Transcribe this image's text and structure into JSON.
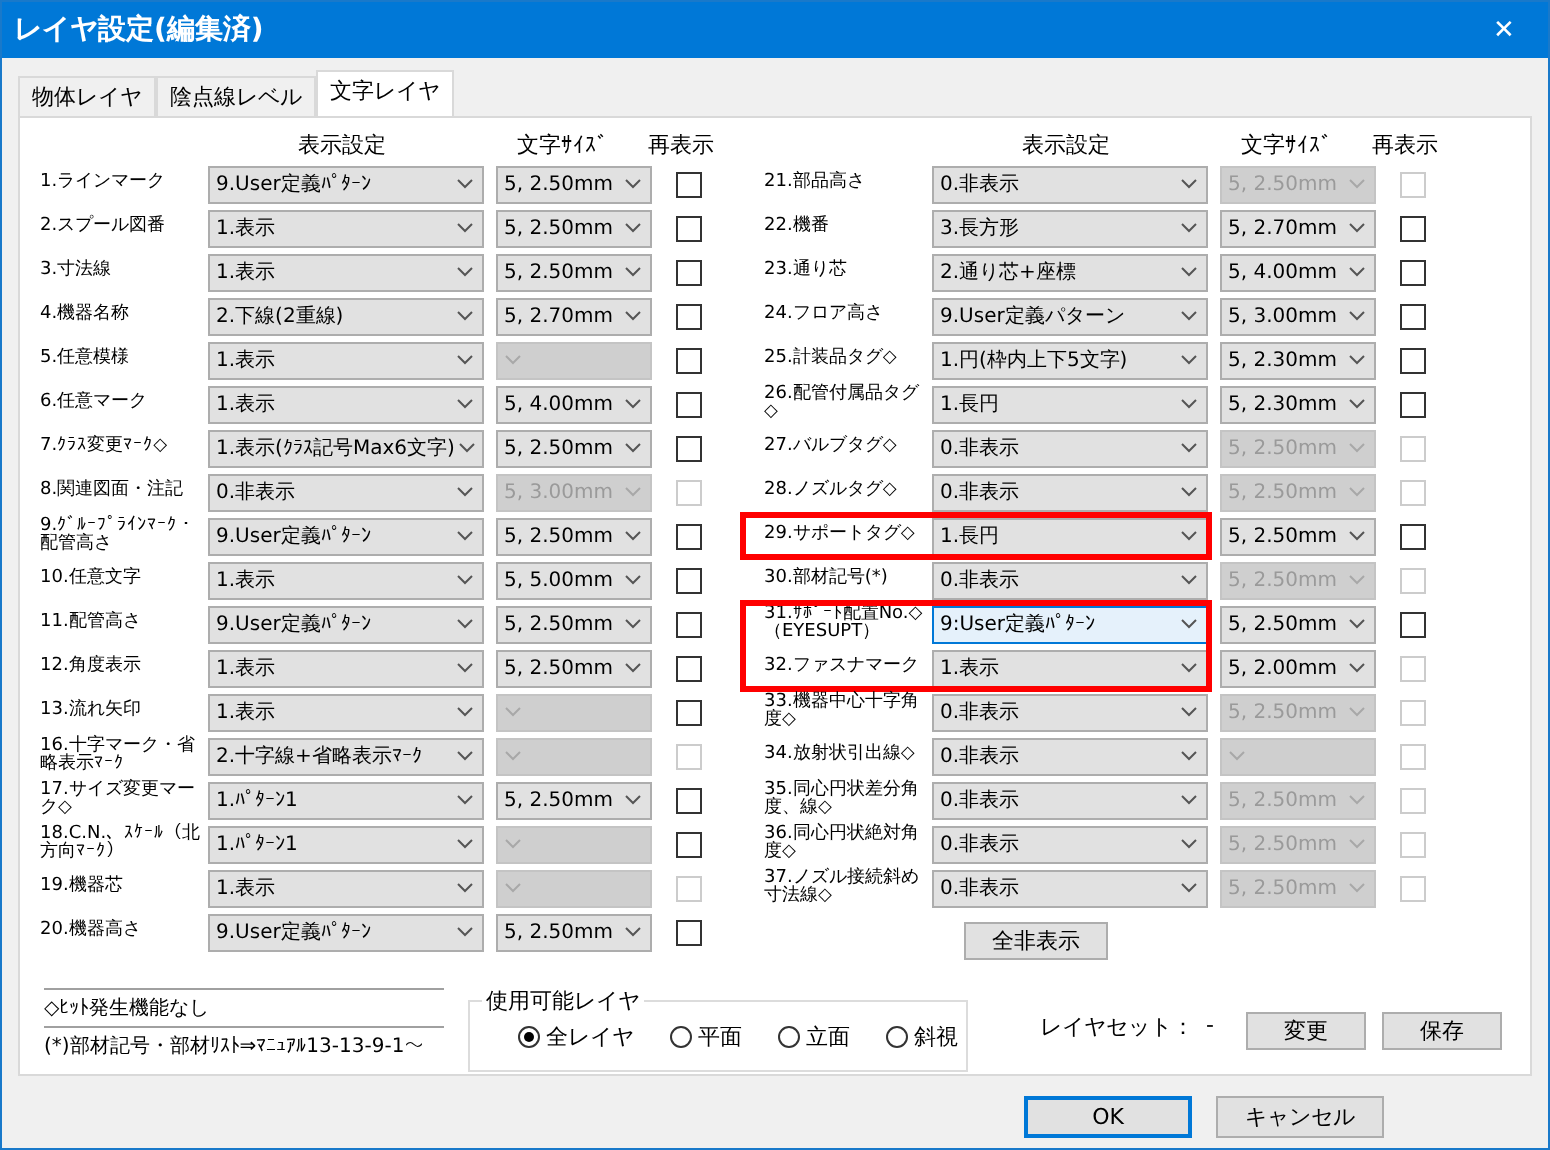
{
  "window": {
    "title": "レイヤ設定(編集済)",
    "close": "✕"
  },
  "tabs": [
    {
      "label": "物体レイヤ",
      "selected": false
    },
    {
      "label": "陰点線レベル",
      "selected": false
    },
    {
      "label": "文字レイヤ",
      "selected": true
    }
  ],
  "columns": [
    {
      "headers": [
        "表示設定",
        "文字ｻｲｽﾞ",
        "再表示"
      ],
      "rows": [
        {
          "label": "1.ラインマーク",
          "setting": "9.User定義ﾊﾟﾀｰﾝ",
          "size": "5, 2.50mm",
          "size_enabled": true,
          "checkbox_disabled": false,
          "checked": false,
          "focused": false,
          "highlighted": false
        },
        {
          "label": "2.スプール図番",
          "setting": "1.表示",
          "size": "5, 2.50mm",
          "size_enabled": true,
          "checkbox_disabled": false,
          "checked": false,
          "focused": false,
          "highlighted": false
        },
        {
          "label": "3.寸法線",
          "setting": "1.表示",
          "size": "5, 2.50mm",
          "size_enabled": true,
          "checkbox_disabled": false,
          "checked": false,
          "focused": false,
          "highlighted": false
        },
        {
          "label": "4.機器名称",
          "setting": "2.下線(2重線)",
          "size": "5, 2.70mm",
          "size_enabled": true,
          "checkbox_disabled": false,
          "checked": false,
          "focused": false,
          "highlighted": false
        },
        {
          "label": "5.任意模様",
          "setting": "1.表示",
          "size_enabled": false,
          "checkbox_disabled": false,
          "checked": false,
          "focused": false,
          "highlighted": false
        },
        {
          "label": "6.任意マーク",
          "setting": "1.表示",
          "size": "5, 4.00mm",
          "size_enabled": true,
          "checkbox_disabled": false,
          "checked": false,
          "focused": false,
          "highlighted": false
        },
        {
          "label": "7.ｸﾗｽ変更ﾏｰｸ◇",
          "setting": "1.表示(ｸﾗｽ記号Max6文字)",
          "size": "5, 2.50mm",
          "size_enabled": true,
          "checkbox_disabled": false,
          "checked": false,
          "focused": false,
          "highlighted": false
        },
        {
          "label": "8.関連図面・注記",
          "setting": "0.非表示",
          "size": "5, 3.00mm",
          "size_enabled": false,
          "checkbox_disabled": true,
          "checked": false,
          "focused": false,
          "highlighted": false
        },
        {
          "label": "9.ｸﾞﾙｰﾌﾟﾗｲﾝﾏｰｸ・配管高さ",
          "setting": "9.User定義ﾊﾟﾀｰﾝ",
          "size": "5, 2.50mm",
          "size_enabled": true,
          "checkbox_disabled": false,
          "checked": false,
          "focused": false,
          "highlighted": false
        },
        {
          "label": "10.任意文字",
          "setting": "1.表示",
          "size": "5, 5.00mm",
          "size_enabled": true,
          "checkbox_disabled": false,
          "checked": false,
          "focused": false,
          "highlighted": false
        },
        {
          "label": "11.配管高さ",
          "setting": "9.User定義ﾊﾟﾀｰﾝ",
          "size": "5, 2.50mm",
          "size_enabled": true,
          "checkbox_disabled": false,
          "checked": false,
          "focused": false,
          "highlighted": false
        },
        {
          "label": "12.角度表示",
          "setting": "1.表示",
          "size": "5, 2.50mm",
          "size_enabled": true,
          "checkbox_disabled": false,
          "checked": false,
          "focused": false,
          "highlighted": false
        },
        {
          "label": "13.流れ矢印",
          "setting": "1.表示",
          "size_enabled": false,
          "checkbox_disabled": false,
          "checked": false,
          "focused": false,
          "highlighted": false
        },
        {
          "label": "16.十字マーク・省略表示ﾏｰｸ",
          "setting": "2.十字線+省略表示ﾏｰｸ",
          "size_enabled": false,
          "checkbox_disabled": true,
          "checked": false,
          "focused": false,
          "highlighted": false
        },
        {
          "label": "17.サイズ変更マーク◇",
          "setting": "1.ﾊﾟﾀｰﾝ1",
          "size": "5, 2.50mm",
          "size_enabled": true,
          "checkbox_disabled": false,
          "checked": false,
          "focused": false,
          "highlighted": false
        },
        {
          "label": "18.C.N.、ｽｹｰﾙ（北方向ﾏｰｸ）",
          "setting": "1.ﾊﾟﾀｰﾝ1",
          "size_enabled": false,
          "checkbox_disabled": false,
          "checked": false,
          "focused": false,
          "highlighted": false
        },
        {
          "label": "19.機器芯",
          "setting": "1.表示",
          "size_enabled": false,
          "checkbox_disabled": true,
          "checked": false,
          "focused": false,
          "highlighted": false
        },
        {
          "label": "20.機器高さ",
          "setting": "9.User定義ﾊﾟﾀｰﾝ",
          "size": "5, 2.50mm",
          "size_enabled": true,
          "checkbox_disabled": false,
          "checked": false,
          "focused": false,
          "highlighted": false
        }
      ]
    },
    {
      "headers": [
        "表示設定",
        "文字ｻｲｽﾞ",
        "再表示"
      ],
      "rows": [
        {
          "label": "21.部品高さ",
          "setting": "0.非表示",
          "size": "5, 2.50mm",
          "size_enabled": false,
          "checkbox_disabled": true,
          "checked": false,
          "focused": false,
          "highlighted": false
        },
        {
          "label": "22.機番",
          "setting": "3.長方形",
          "size": "5, 2.70mm",
          "size_enabled": true,
          "checkbox_disabled": false,
          "checked": false,
          "focused": false,
          "highlighted": false
        },
        {
          "label": "23.通り芯",
          "setting": "2.通り芯+座標",
          "size": "5, 4.00mm",
          "size_enabled": true,
          "checkbox_disabled": false,
          "checked": false,
          "focused": false,
          "highlighted": false
        },
        {
          "label": "24.フロア高さ",
          "setting": "9.User定義パターン",
          "size": "5, 3.00mm",
          "size_enabled": true,
          "checkbox_disabled": false,
          "checked": false,
          "focused": false,
          "highlighted": false
        },
        {
          "label": "25.計装品タグ◇",
          "setting": "1.円(枠内上下5文字)",
          "size": "5, 2.30mm",
          "size_enabled": true,
          "checkbox_disabled": false,
          "checked": false,
          "focused": false,
          "highlighted": false
        },
        {
          "label": "26.配管付属品タグ◇",
          "setting": "1.長円",
          "size": "5, 2.30mm",
          "size_enabled": true,
          "checkbox_disabled": false,
          "checked": false,
          "focused": false,
          "highlighted": false
        },
        {
          "label": "27.バルブタグ◇",
          "setting": "0.非表示",
          "size": "5, 2.50mm",
          "size_enabled": false,
          "checkbox_disabled": true,
          "checked": false,
          "focused": false,
          "highlighted": false
        },
        {
          "label": "28.ノズルタグ◇",
          "setting": "0.非表示",
          "size": "5, 2.50mm",
          "size_enabled": false,
          "checkbox_disabled": true,
          "checked": false,
          "focused": false,
          "highlighted": false
        },
        {
          "label": "29.サポートタグ◇",
          "setting": "1.長円",
          "size": "5, 2.50mm",
          "size_enabled": true,
          "checkbox_disabled": false,
          "checked": false,
          "focused": false,
          "highlighted": true
        },
        {
          "label": "30.部材記号(*)",
          "setting": "0.非表示",
          "size": "5, 2.50mm",
          "size_enabled": false,
          "checkbox_disabled": true,
          "checked": false,
          "focused": false,
          "highlighted": false
        },
        {
          "label": "31.ｻﾎﾟｰﾄ配置No.◇（EYESUPT）",
          "setting": "9:User定義ﾊﾟﾀｰﾝ",
          "size": "5, 2.50mm",
          "size_enabled": true,
          "checkbox_disabled": false,
          "checked": false,
          "focused": true,
          "highlighted": true
        },
        {
          "label": "32.ファスナマーク",
          "setting": "1.表示",
          "size": "5, 2.00mm",
          "size_enabled": true,
          "checkbox_disabled": true,
          "checked": false,
          "focused": false,
          "highlighted": true
        },
        {
          "label": "33.機器中心十字角度◇",
          "setting": "0.非表示",
          "size": "5, 2.50mm",
          "size_enabled": false,
          "checkbox_disabled": true,
          "checked": false,
          "focused": false,
          "highlighted": false
        },
        {
          "label": "34.放射状引出線◇",
          "setting": "0.非表示",
          "size_enabled": false,
          "checkbox_disabled": true,
          "checked": false,
          "focused": false,
          "highlighted": false
        },
        {
          "label": "35.同心円状差分角度、線◇",
          "setting": "0.非表示",
          "size": "5, 2.50mm",
          "size_enabled": false,
          "checkbox_disabled": true,
          "checked": false,
          "focused": false,
          "highlighted": false
        },
        {
          "label": "36.同心円状絶対角度◇",
          "setting": "0.非表示",
          "size": "5, 2.50mm",
          "size_enabled": false,
          "checkbox_disabled": true,
          "checked": false,
          "focused": false,
          "highlighted": false
        },
        {
          "label": "37.ノズル接続斜め寸法線◇",
          "setting": "0.非表示",
          "size": "5, 2.50mm",
          "size_enabled": false,
          "checkbox_disabled": true,
          "checked": false,
          "focused": false,
          "highlighted": false
        }
      ],
      "button": "全非表示"
    }
  ],
  "notes": [
    "◇ﾋｯﾄ発生機能なし",
    "(*)部材記号・部材ﾘｽﾄ⇒ﾏﾆｭｱﾙ13-13-9-1～"
  ],
  "layer_group": {
    "title": "使用可能レイヤ",
    "options": [
      {
        "label": "全レイヤ",
        "selected": true
      },
      {
        "label": "平面",
        "selected": false
      },
      {
        "label": "立面",
        "selected": false
      },
      {
        "label": "斜視",
        "selected": false
      }
    ]
  },
  "layer_set": {
    "label": "レイヤセット：",
    "value": "-"
  },
  "set_buttons": [
    "変更",
    "保存"
  ],
  "dialog_buttons": [
    {
      "label": "OK",
      "default": true
    },
    {
      "label": "キャンセル",
      "default": false
    }
  ]
}
